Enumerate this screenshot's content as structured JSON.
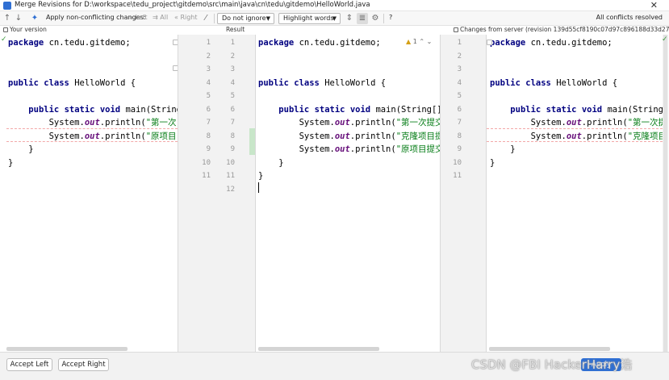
{
  "window": {
    "title": "Merge Revisions for D:\\workspace\\tedu_project\\gitdemo\\src\\main\\java\\cn\\tedu\\gitdemo\\HelloWorld.java"
  },
  "toolbar": {
    "apply_label": "Apply non-conflicting changes:",
    "left_label": "Left",
    "all_label": "All",
    "right_label": "Right",
    "ignore_select": "Do not ignore",
    "highlight_select": "Highlight words",
    "help_label": "?",
    "status": "All conflicts resolved"
  },
  "panes": {
    "left_header": "Your version",
    "result_header": "Result",
    "right_header": "Changes from server (revision 139d55cf8190c07d97c896188d33d27..."
  },
  "conflict_info": {
    "count": "1"
  },
  "left_code": [
    "package cn.tedu.gitdemo;",
    "",
    "",
    "public class HelloWorld {",
    "",
    "    public static void main(String",
    "        System.out.println(\"第一次",
    "        System.out.println(\"原项目",
    "    }",
    "}",
    ""
  ],
  "center_left_numbers": [
    "1",
    "2",
    "3",
    "4",
    "5",
    "6",
    "7",
    "8",
    "9",
    "10",
    "11"
  ],
  "center_right_numbers": [
    "1",
    "2",
    "3",
    "4",
    "5",
    "6",
    "7",
    "8",
    "9",
    "10",
    "11",
    "12"
  ],
  "result_code": [
    "package cn.tedu.gitdemo;",
    "",
    "",
    "public class HelloWorld {",
    "",
    "    public static void main(String[]",
    "        System.out.println(\"第一次提交",
    "        System.out.println(\"克隆项目提",
    "        System.out.println(\"原项目提交",
    "    }",
    "}",
    ""
  ],
  "right_numbers": [
    "1",
    "2",
    "3",
    "4",
    "5",
    "6",
    "7",
    "8",
    "9",
    "10",
    "11"
  ],
  "right_code": [
    "package cn.tedu.gitdemo;",
    "",
    "",
    "public class HelloWorld {",
    "",
    "    public static void main(String[]",
    "        System.out.println(\"第一次提",
    "        System.out.println(\"克隆项目提",
    "    }",
    "}",
    ""
  ],
  "footer": {
    "accept_left": "Accept Left",
    "accept_right": "Accept Right",
    "apply": "Apply"
  },
  "watermark": "CSDN @FBI HackerHarry浩",
  "colors": {
    "accent": "#2f6fd3",
    "change_green": "#c8e6c9",
    "keyword": "#000080",
    "field": "#660e7a",
    "string": "#067d17"
  }
}
